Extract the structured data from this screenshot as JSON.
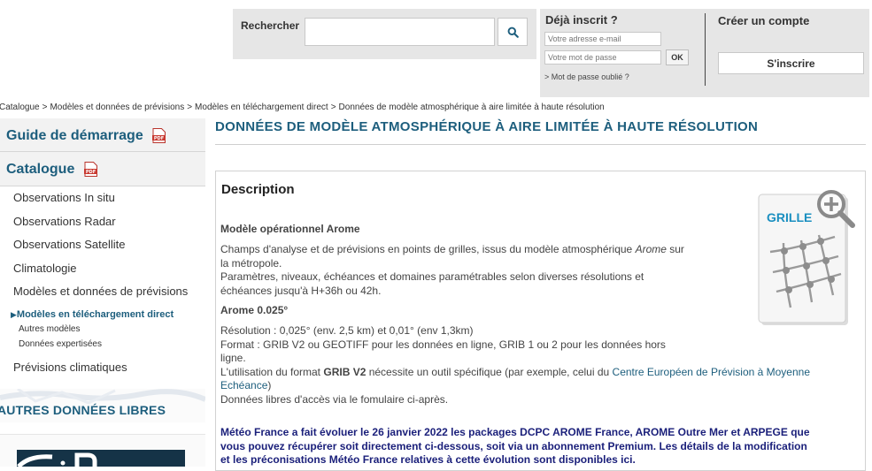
{
  "search": {
    "label": "Rechercher",
    "value": "",
    "placeholder": "",
    "button_icon": "search-icon"
  },
  "login": {
    "title": "Déjà inscrit ?",
    "email_placeholder": "Votre adresse e-mail",
    "password_placeholder": "Votre mot de passe",
    "ok_label": "OK",
    "forgot_label": "> Mot de passe oublié ?",
    "create_title": "Créer un compte",
    "signup_label": "S'inscrire"
  },
  "breadcrumb": [
    "Catalogue",
    "Modèles et données de prévisions",
    "Modèles en téléchargement direct",
    "Données de modèle atmosphérique à aire limitée à haute résolution"
  ],
  "breadcrumb_sep": ">",
  "sidebar": {
    "guide_label": "Guide de démarrage",
    "catalogue_label": "Catalogue",
    "pdf_icon": "pdf-icon",
    "items": [
      "Observations In situ",
      "Observations Radar",
      "Observations Satellite",
      "Climatologie",
      "Modèles et données de prévisions"
    ],
    "active_arrow": "▶",
    "active_label": "Modèles en téléchargement direct",
    "sub_items": [
      "Autres modèles",
      "Données expertisées"
    ],
    "after_item": "Prévisions climatiques",
    "libres_title": "AUTRES DONNÉES LIBRES"
  },
  "main": {
    "title": "DONNÉES DE MODÈLE ATMOSPHÉRIQUE À AIRE LIMITÉE À HAUTE RÉSOLUTION",
    "description_title": "Description",
    "model_head": "Modèle opérationnel Arome",
    "para1_a": "Champs d'analyse et de prévisions en points de grilles, issus du modèle atmosphérique ",
    "para1_em": "Arome",
    "para1_b": " sur",
    "para1_line2": "la métropole.",
    "para2_line1": "Paramètres, niveaux, échéances et domaines paramétrables selon diverses résolutions et",
    "para2_line2": "échéances jusqu'à H+36h ou 42h.",
    "arome_head": "Arome 0.025°",
    "res_line": "Résolution : 0,025° (env. 2,5 km) et 0,01° (env 1,3km)",
    "format_line1": "Format : GRIB V2 ou GEOTIFF pour les données en ligne, GRIB 1 ou 2 pour les données hors",
    "format_line2": "ligne.",
    "util_a": "L'utilisation du format ",
    "util_b": "GRIB V2",
    "util_c": " nécessite un outil spécifique (par exemple, celui du ",
    "util_link1": "Centre Européen de Prévision à Moyenne",
    "util_link2": "Echéance",
    "util_d": ")",
    "libres_line": "Données libres d'accès via le fomulaire ci-après.",
    "notice_line1": "Météo France a fait évoluer le 26 janvier 2022 les packages DCPC AROME France, AROME Outre Mer et ARPEGE que",
    "notice_line2": "vous pouvez récupérer soit directement ci-dessous, soit via un abonnement Premium. Les détails de la modification",
    "notice_line3": "et les préconisations Météo France relatives à cette évolution sont disponibles ici.",
    "grille_label": "GRILLE",
    "zoom_icon": "zoom-icon"
  },
  "colors": {
    "brand_blue": "#1d5e7d",
    "notice_blue": "#1a1f7a",
    "panel_grey": "#e6e6e6"
  }
}
